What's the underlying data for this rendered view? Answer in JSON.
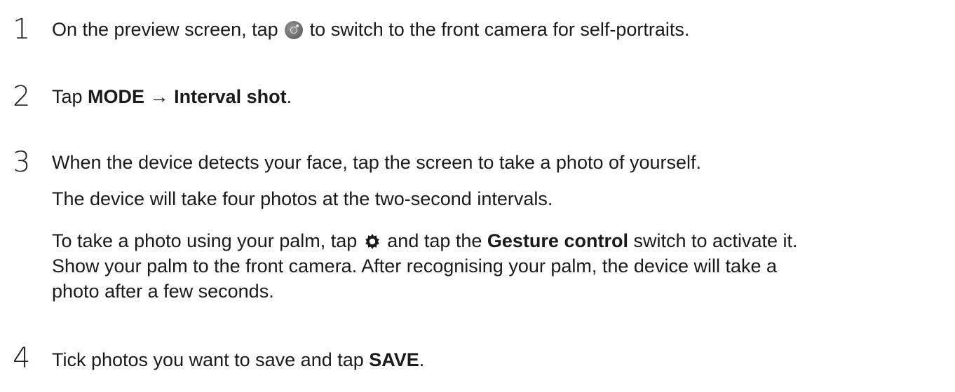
{
  "steps": [
    {
      "number": "1",
      "line1_before": "On the preview screen, tap ",
      "line1_after": " to switch to the front camera for self-portraits.",
      "icon": "camera-switch-icon"
    },
    {
      "number": "2",
      "prefix": "Tap ",
      "bold1": "MODE",
      "arrow": " → ",
      "bold2": "Interval shot",
      "suffix": "."
    },
    {
      "number": "3",
      "line1": "When the device detects your face, tap the screen to take a photo of yourself.",
      "line2": "The device will take four photos at the two-second intervals.",
      "line3_before": "To take a photo using your palm, tap ",
      "line3_icon": "settings-gear-icon",
      "line3_mid": " and tap the ",
      "line3_bold": "Gesture control",
      "line3_after": " switch to activate it.",
      "line4": "Show your palm to the front camera. After recognising your palm, the device will take a",
      "line5": "photo after a few seconds."
    },
    {
      "number": "4",
      "prefix": "Tick photos you want to save and tap ",
      "bold": "SAVE",
      "suffix": "."
    }
  ]
}
